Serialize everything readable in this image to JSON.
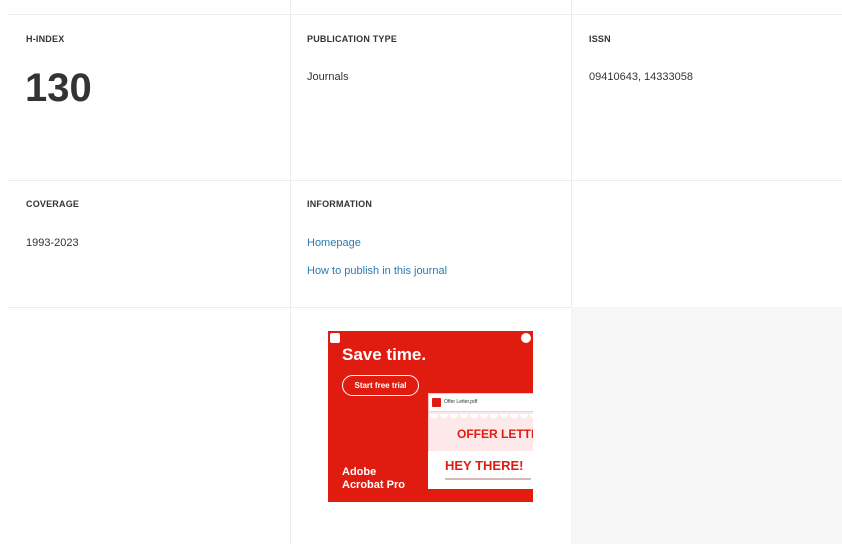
{
  "metrics": {
    "h_index": {
      "label": "H-INDEX",
      "value": "130"
    },
    "publication_type": {
      "label": "PUBLICATION TYPE",
      "value": "Journals"
    },
    "issn": {
      "label": "ISSN",
      "value": "09410643, 14333058"
    },
    "coverage": {
      "label": "COVERAGE",
      "value": "1993-2023"
    },
    "information": {
      "label": "INFORMATION",
      "links": [
        "Homepage",
        "How to publish in this journal"
      ]
    }
  },
  "ad": {
    "headline": "Save time.",
    "cta": "Start free trial",
    "doc_name": "Offer Letter.pdf",
    "offer_text": "OFFER LETTE",
    "hey_text": "HEY THERE!",
    "brand_line1": "Adobe",
    "brand_line2": "Acrobat Pro",
    "icons": [
      "adchoices-icon",
      "ad-info-icon",
      "pdf-icon",
      "seal-icon"
    ],
    "colors": {
      "background": "#e01c10",
      "text": "#ffffff"
    }
  },
  "colors": {
    "link": "#2a7bb0",
    "divider": "#ececec",
    "empty_cell": "#f6f6f6"
  }
}
